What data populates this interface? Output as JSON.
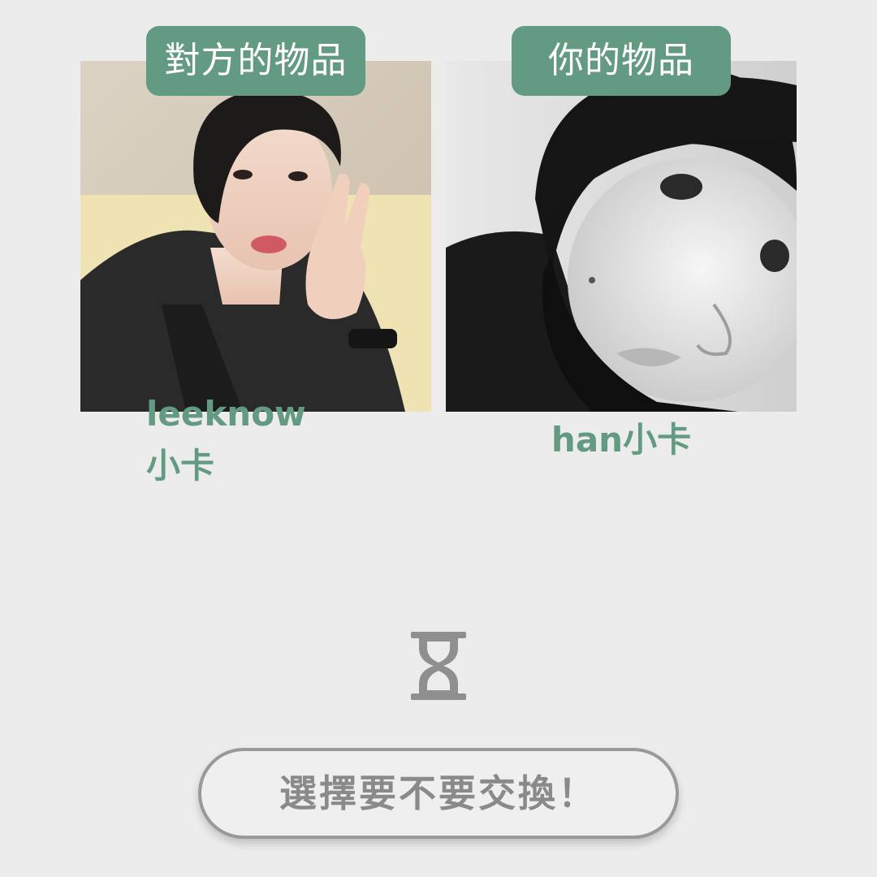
{
  "offer": {
    "their_item": {
      "tag_label": "對方的物品",
      "item_name": "leeknow小卡"
    },
    "your_item": {
      "tag_label": "你的物品",
      "item_name": "han小卡"
    }
  },
  "status": {
    "icon": "hourglass-icon"
  },
  "action": {
    "button_label": "選擇要不要交換！"
  },
  "colors": {
    "accent": "#639a82",
    "background": "#ececec",
    "button_text": "#8a8a8a",
    "button_border": "#999999"
  }
}
